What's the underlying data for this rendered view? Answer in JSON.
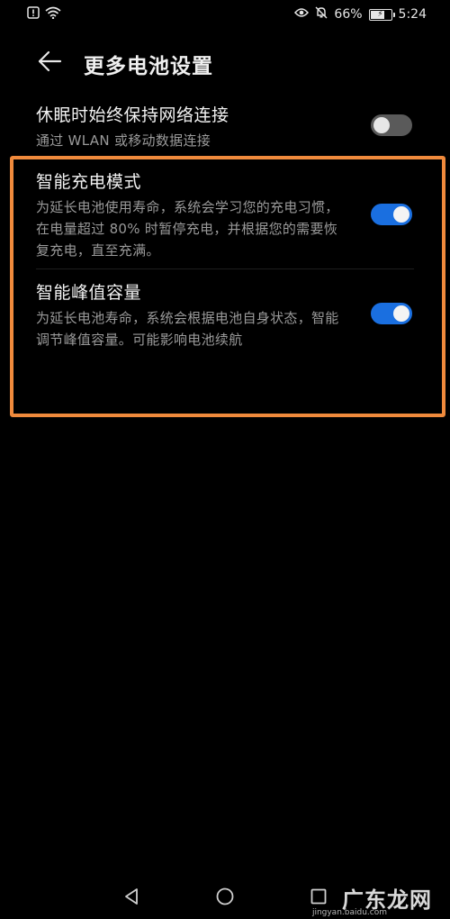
{
  "status_bar": {
    "battery_percent": "66%",
    "battery_level": 0.66,
    "time": "5:24",
    "icons": [
      "alert-icon",
      "wifi-icon",
      "eye-icon",
      "mute-icon",
      "battery-icon"
    ]
  },
  "header": {
    "back_icon": "back-arrow-icon",
    "title": "更多电池设置"
  },
  "settings": [
    {
      "title": "休眠时始终保持网络连接",
      "description": "通过 WLAN 或移动数据连接",
      "enabled": false
    },
    {
      "title": "智能充电模式",
      "description": "为延长电池使用寿命，系统会学习您的充电习惯，在电量超过 80% 时暂停充电，并根据您的需要恢复充电，直至充满。",
      "enabled": true
    },
    {
      "title": "智能峰值容量",
      "description": "为延长电池寿命，系统会根据电池自身状态，智能调节峰值容量。可能影响电池续航",
      "enabled": true
    }
  ],
  "nav_bar": {
    "icons": [
      "back-triangle-icon",
      "home-circle-icon",
      "recents-square-icon"
    ]
  },
  "watermark": {
    "text": "广东龙网",
    "subtext": "jingyan.baidu.com"
  },
  "colors": {
    "background": "#000000",
    "accent": "#1a6fe0",
    "highlight": "#f08a3c",
    "toggle_off": "#5a5a5a"
  }
}
